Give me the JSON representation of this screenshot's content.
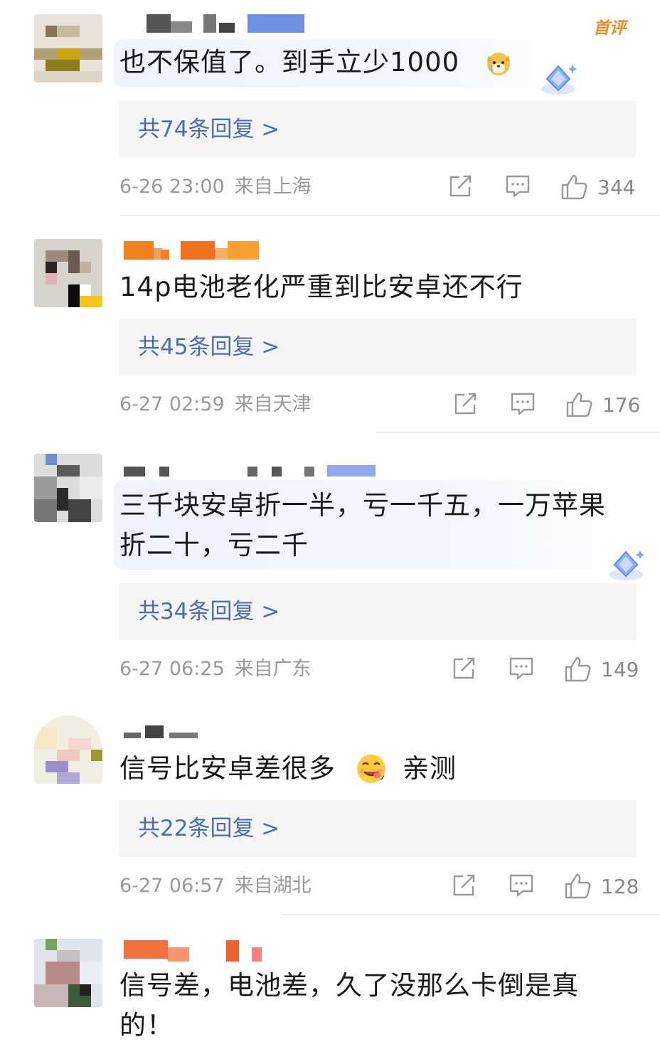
{
  "comments": [
    {
      "text": "也不保值了。到手立少1000",
      "replies": "共74条回复 >",
      "time": "6-26 23:00",
      "location": "来自上海",
      "likes": "344",
      "badge": "首评"
    },
    {
      "text": "14p电池老化严重到比安卓还不行",
      "replies": "共45条回复 >",
      "time": "6-27 02:59",
      "location": "来自天津",
      "likes": "176"
    },
    {
      "text": "三千块安卓折一半，亏一千五，一万苹果折二十，亏二千",
      "replies": "共34条回复 >",
      "time": "6-27 06:25",
      "location": "来自广东",
      "likes": "149"
    },
    {
      "text": "信号比安卓差很多",
      "text_after_emoji": "，亲测",
      "replies": "共22条回复 >",
      "time": "6-27 06:57",
      "location": "来自湖北",
      "likes": "128"
    },
    {
      "text": "信号差，电池差，久了没那么卡倒是真的！"
    }
  ],
  "icons": {
    "share": "share-icon",
    "comment": "comment-icon",
    "like": "thumbs-up-icon",
    "diamond": "diamond-badge-icon",
    "emoji_dog": "dog-emoji-icon",
    "emoji_face": "yummy-face-emoji-icon"
  },
  "colors": {
    "reply_link": "#4a6db3",
    "meta_gray": "#999999",
    "badge_orange": "#f08a26",
    "highlight_bg": "#eef3ff"
  }
}
